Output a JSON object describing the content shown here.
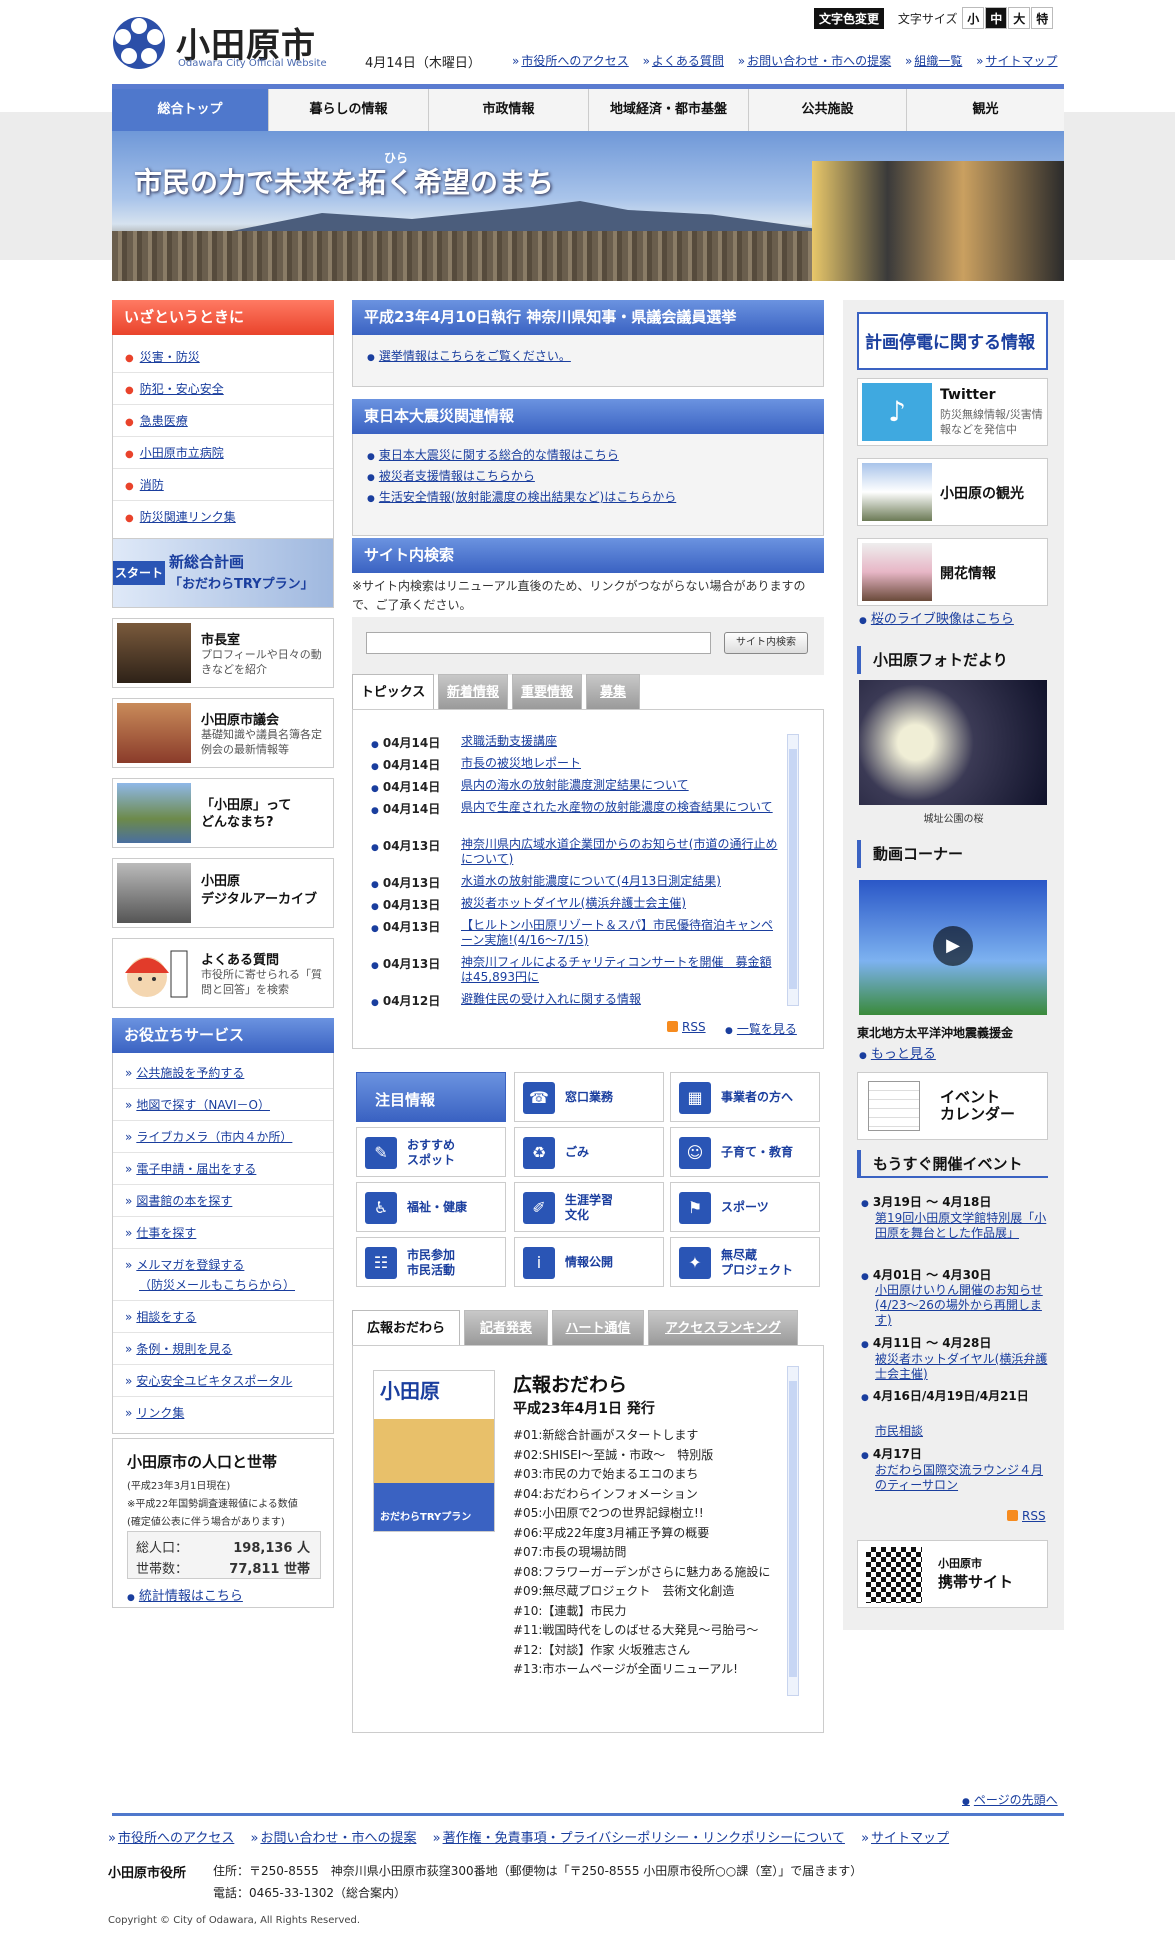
{
  "header": {
    "logo_title": "小田原市",
    "logo_sub": "Odawara City Official Website",
    "date": "4月14日（木曜日）",
    "links": [
      "市役所へのアクセス",
      "よくある質問",
      "お問い合わせ・市への提案",
      "組織一覧",
      "サイトマップ"
    ],
    "tool_color": "文字色変更",
    "tool_size": "文字サイズ",
    "size_small": "小",
    "size_mid": "中",
    "size_large": "大",
    "size_special": "特"
  },
  "nav": [
    "総合トップ",
    "暮らしの情報",
    "市政情報",
    "地域経済・都市基盤",
    "公共施設",
    "観光"
  ],
  "hero": {
    "text": "市民の力で未来を拓く希望のまち",
    "ruby": "ひら"
  },
  "left": {
    "emergency_title": "いざというときに",
    "emergency_items": [
      "災害・防災",
      "防犯・安心安全",
      "急患医療",
      "小田原市立病院",
      "消防",
      "防災関連リンク集"
    ],
    "plan_banner": {
      "label": "スタート",
      "title": "新総合計画",
      "sub": "「おだわらTRYプラン」"
    },
    "banners": [
      {
        "title": "市長室",
        "desc": "プロフィールや日々の動きなどを紹介"
      },
      {
        "title": "小田原市議会",
        "desc": "基礎知識や議員名簿各定例会の最新情報等"
      },
      {
        "title": "「小田原」って\nどんなまち?",
        "desc": ""
      },
      {
        "title": "小田原\nデジタルアーカイブ",
        "desc": ""
      },
      {
        "title": "よくある質問",
        "desc": "市役所に寄せられる「質問と回答」を検索"
      }
    ],
    "service_title": "お役立ちサービス",
    "services": [
      "公共施設を予約する",
      "地図で探す（NAVI－O）",
      "ライブカメラ（市内４か所）",
      "電子申請・届出をする",
      "図書館の本を探す",
      "仕事を探す",
      "メルマガを登録する",
      "（防災メールもこちらから）",
      "相談をする",
      "条例・規則を見る",
      "安心安全ユビキタスポータル",
      "リンク集"
    ],
    "pop": {
      "title": "小田原市の人口と世帯",
      "date": "(平成23年3月1日現在)",
      "note1": "※平成22年国勢調査速報値による数値",
      "note2": "(確定値公表に伴う場合があります)",
      "pop_label": "総人口：",
      "pop_value": "198,136 人",
      "house_label": "世帯数：",
      "house_value": "77,811 世帯",
      "link": "統計情報はこちら"
    }
  },
  "mid": {
    "election_title": "平成23年4月10日執行 神奈川県知事・県議会議員選挙",
    "election_link": "選挙情報はこちらをご覧ください。",
    "quake_title": "東日本大震災関連情報",
    "quake_links": [
      "東日本大震災に関する総合的な情報はこちら",
      "被災者支援情報はこちらから",
      "生活安全情報(放射能濃度の検出結果など)はこちらから"
    ],
    "search_title": "サイト内検索",
    "search_note": "※サイト内検索はリニューアル直後のため、リンクがつながらない場合がありますので、ご了承ください。",
    "search_button": "サイト内検索",
    "search_value": "",
    "tabs": [
      "トピックス",
      "新着情報",
      "重要情報",
      "募集"
    ],
    "news": [
      {
        "d": "04月14日",
        "t": "求職活動支援講座"
      },
      {
        "d": "04月14日",
        "t": "市長の被災地レポート"
      },
      {
        "d": "04月14日",
        "t": "県内の海水の放射能濃度測定結果について"
      },
      {
        "d": "04月14日",
        "t": "県内で生産された水産物の放射能濃度の検査結果について"
      },
      {
        "d": "04月13日",
        "t": "神奈川県内広域水道企業団からのお知らせ(市道の通行止めについて)"
      },
      {
        "d": "04月13日",
        "t": "水道水の放射能濃度について(4月13日測定結果)"
      },
      {
        "d": "04月13日",
        "t": "被災者ホットダイヤル(横浜弁護士会主催)"
      },
      {
        "d": "04月13日",
        "t": "【ヒルトン小田原リゾート＆スパ】市民優待宿泊キャンペーン実施!(4/16～7/15)"
      },
      {
        "d": "04月13日",
        "t": "神奈川フィルによるチャリティコンサートを開催　募金額は45,893円に"
      },
      {
        "d": "04月12日",
        "t": "避難住民の受け入れに関する情報"
      }
    ],
    "rss": "RSS",
    "more": "一覧を見る",
    "tiles": [
      "注目情報",
      "窓口業務",
      "事業者の方へ",
      "おすすめ\nスポット",
      "ごみ",
      "子育て・教育",
      "福祉・健康",
      "生涯学習\n文化",
      "スポーツ",
      "市民参加\n市民活動",
      "情報公開",
      "無尽蔵\nプロジェクト"
    ],
    "ptabs": [
      "広報おだわら",
      "記者発表",
      "ハート通信",
      "アクセスランキング"
    ],
    "koho_title": "広報おだわら",
    "koho_issue": "平成23年4月1日 発行",
    "koho_cover": "小田原",
    "koho_cover_sub": "おだわらTRYプラン",
    "koho_items": [
      "#01:新総合計画がスタートします",
      "#02:SHISEI～至誠・市政～　特別版",
      "#03:市民の力で始まるエコのまち",
      "#04:おだわらインフォメーション",
      "#05:小田原で2つの世界記録樹立!!",
      "#06:平成22年度3月補正予算の概要",
      "#07:市長の現場訪問",
      "#08:フラワーガーデンがさらに魅力ある施設に",
      "#09:無尽蔵プロジェクト　芸術文化創造",
      "#10:【連載】市民力",
      "#11:戦国時代をしのばせる大発見～弓胎弓～",
      "#12:【対談】作家 火坂雅志さん",
      "#13:市ホームページが全面リニューアル!"
    ]
  },
  "right": {
    "blackout": "計画停電に関する情報",
    "twitter_title": "Twitter",
    "twitter_desc": "防災無線情報/災害情報などを発信中",
    "kanko": "小田原の観光",
    "kaika": "開花情報",
    "sakura_link": "桜のライブ映像はこちら",
    "photo_title": "小田原フォトだより",
    "photo_caption": "城址公園の桜",
    "movie_title": "動画コーナー",
    "movie_caption": "東北地方太平洋沖地震義援金",
    "movie_more": "もっと見る",
    "event_cal": "イベント\nカレンダー",
    "events_title": "もうすぐ開催イベント",
    "events": [
      {
        "d": "3月19日 ～ 4月18日",
        "t": "第19回小田原文学館特別展「小田原を舞台とした作品展」"
      },
      {
        "d": "4月01日 ～ 4月30日",
        "t": "小田原けいりん開催のお知らせ(4/23～26の場外から再開します)"
      },
      {
        "d": "4月11日 ～ 4月28日",
        "t": "被災者ホットダイヤル(横浜弁護士会主催)"
      },
      {
        "d": "4月16日/4月19日/4月21日",
        "t": "市民相談"
      },
      {
        "d": "4月17日",
        "t": "おだわら国際交流ラウンジ４月のティーサロン"
      }
    ],
    "rss": "RSS",
    "mobile_label": "小田原市",
    "mobile_title": "携帯サイト"
  },
  "footer": {
    "pagetop": "ページの先頭へ",
    "links": [
      "市役所へのアクセス",
      "お問い合わせ・市への提案",
      "著作権・免責事項・プライバシーポリシー・リンクポリシーについて",
      "サイトマップ"
    ],
    "name": "小田原市役所",
    "address": "住所：〒250-8555　神奈川県小田原市荻窪300番地（郵便物は「〒250-8555 小田原市役所○○課（室）」で届きます）",
    "tel": "電話：0465-33-1302（総合案内）",
    "copyright": "Copyright © City of Odawara, All Rights Reserved."
  }
}
